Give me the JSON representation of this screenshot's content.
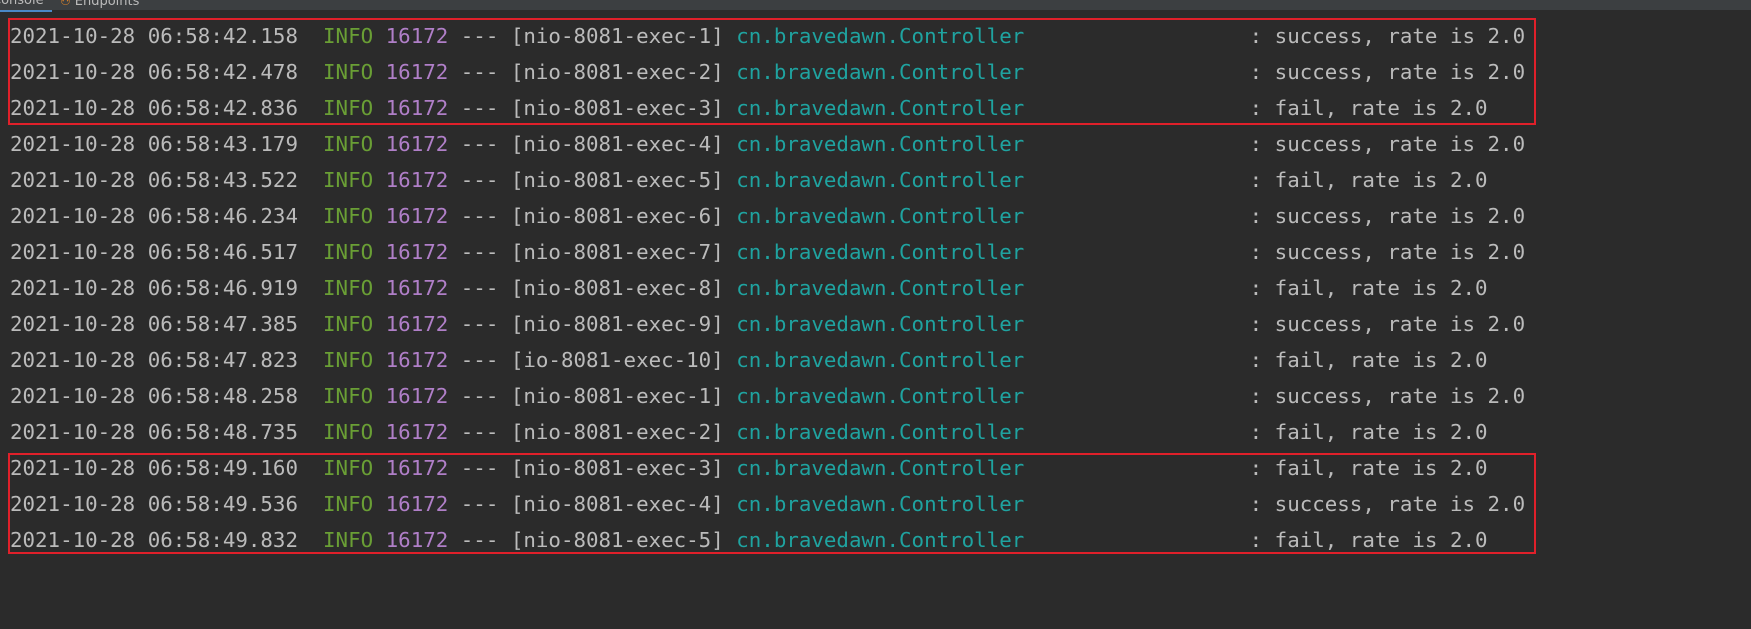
{
  "tabs": [
    {
      "label": "Console",
      "icon": "console"
    },
    {
      "label": "Endpoints",
      "icon": "endpoints-icon"
    }
  ],
  "colors": {
    "text": "#bbbbbb",
    "level": "#6a9f35",
    "pid": "#b07fc8",
    "logger": "#1fa3a0",
    "highlight": "#e0202a",
    "background": "#2b2b2b"
  },
  "log_lines": [
    {
      "ts": "2021-10-28 06:58:42.158",
      "level": "INFO",
      "pid": "16172",
      "thread": "[nio-8081-exec-1]",
      "logger": "cn.bravedawn.Controller",
      "msg": "success, rate is 2.0"
    },
    {
      "ts": "2021-10-28 06:58:42.478",
      "level": "INFO",
      "pid": "16172",
      "thread": "[nio-8081-exec-2]",
      "logger": "cn.bravedawn.Controller",
      "msg": "success, rate is 2.0"
    },
    {
      "ts": "2021-10-28 06:58:42.836",
      "level": "INFO",
      "pid": "16172",
      "thread": "[nio-8081-exec-3]",
      "logger": "cn.bravedawn.Controller",
      "msg": "fail, rate is 2.0"
    },
    {
      "ts": "2021-10-28 06:58:43.179",
      "level": "INFO",
      "pid": "16172",
      "thread": "[nio-8081-exec-4]",
      "logger": "cn.bravedawn.Controller",
      "msg": "success, rate is 2.0"
    },
    {
      "ts": "2021-10-28 06:58:43.522",
      "level": "INFO",
      "pid": "16172",
      "thread": "[nio-8081-exec-5]",
      "logger": "cn.bravedawn.Controller",
      "msg": "fail, rate is 2.0"
    },
    {
      "ts": "2021-10-28 06:58:46.234",
      "level": "INFO",
      "pid": "16172",
      "thread": "[nio-8081-exec-6]",
      "logger": "cn.bravedawn.Controller",
      "msg": "success, rate is 2.0"
    },
    {
      "ts": "2021-10-28 06:58:46.517",
      "level": "INFO",
      "pid": "16172",
      "thread": "[nio-8081-exec-7]",
      "logger": "cn.bravedawn.Controller",
      "msg": "success, rate is 2.0"
    },
    {
      "ts": "2021-10-28 06:58:46.919",
      "level": "INFO",
      "pid": "16172",
      "thread": "[nio-8081-exec-8]",
      "logger": "cn.bravedawn.Controller",
      "msg": "fail, rate is 2.0"
    },
    {
      "ts": "2021-10-28 06:58:47.385",
      "level": "INFO",
      "pid": "16172",
      "thread": "[nio-8081-exec-9]",
      "logger": "cn.bravedawn.Controller",
      "msg": "success, rate is 2.0"
    },
    {
      "ts": "2021-10-28 06:58:47.823",
      "level": "INFO",
      "pid": "16172",
      "thread": "[io-8081-exec-10]",
      "logger": "cn.bravedawn.Controller",
      "msg": "fail, rate is 2.0"
    },
    {
      "ts": "2021-10-28 06:58:48.258",
      "level": "INFO",
      "pid": "16172",
      "thread": "[nio-8081-exec-1]",
      "logger": "cn.bravedawn.Controller",
      "msg": "success, rate is 2.0"
    },
    {
      "ts": "2021-10-28 06:58:48.735",
      "level": "INFO",
      "pid": "16172",
      "thread": "[nio-8081-exec-2]",
      "logger": "cn.bravedawn.Controller",
      "msg": "fail, rate is 2.0"
    },
    {
      "ts": "2021-10-28 06:58:49.160",
      "level": "INFO",
      "pid": "16172",
      "thread": "[nio-8081-exec-3]",
      "logger": "cn.bravedawn.Controller",
      "msg": "fail, rate is 2.0"
    },
    {
      "ts": "2021-10-28 06:58:49.536",
      "level": "INFO",
      "pid": "16172",
      "thread": "[nio-8081-exec-4]",
      "logger": "cn.bravedawn.Controller",
      "msg": "success, rate is 2.0"
    },
    {
      "ts": "2021-10-28 06:58:49.832",
      "level": "INFO",
      "pid": "16172",
      "thread": "[nio-8081-exec-5]",
      "logger": "cn.bravedawn.Controller",
      "msg": "fail, rate is 2.0"
    }
  ],
  "highlighted_line_groups": [
    [
      1,
      3
    ],
    [
      13,
      15
    ]
  ]
}
